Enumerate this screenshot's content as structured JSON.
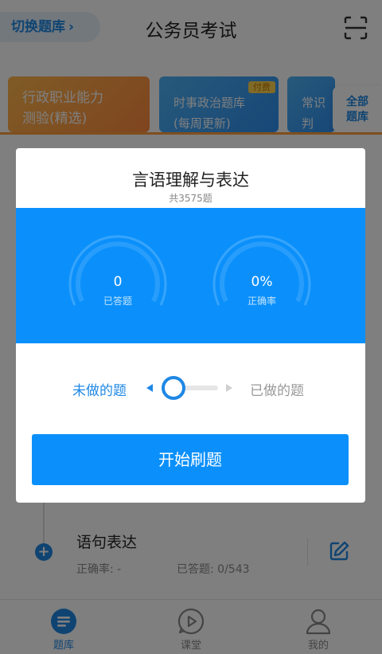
{
  "header": {
    "switch_label": "切换题库",
    "switch_chevron": "›",
    "title": "公务员考试",
    "scan_icon": "scan-icon"
  },
  "categories": [
    {
      "line1": "行政职业能力",
      "line2": "测验(精选)"
    },
    {
      "line1": "时事政治题库",
      "line2": "(每周更新)",
      "badge": "付费"
    },
    {
      "line1": "常识判",
      "line2": "题库"
    }
  ],
  "all_bank": {
    "line1": "全部",
    "line2": "题库"
  },
  "list_item": {
    "title": "语句表达",
    "rate_label": "正确率: -",
    "answered_label": "已答题: 0/543",
    "add_icon": "plus-icon",
    "edit_icon": "edit-icon"
  },
  "tabbar": [
    {
      "label": "题库",
      "icon": "question-bank-icon",
      "active": true
    },
    {
      "label": "课堂",
      "icon": "play-icon",
      "active": false
    },
    {
      "label": "我的",
      "icon": "user-icon",
      "active": false
    }
  ],
  "modal": {
    "title": "言语理解与表达",
    "subtitle": "共3575题",
    "stats": [
      {
        "value": "0",
        "label": "已答题"
      },
      {
        "value": "0%",
        "label": "正确率"
      }
    ],
    "mode_left": "未做的题",
    "mode_right": "已做的题",
    "start_label": "开始刷题"
  },
  "colors": {
    "accent": "#0b90fb",
    "brand_blue": "#1e88e5",
    "orange": "#ff8a3d"
  }
}
